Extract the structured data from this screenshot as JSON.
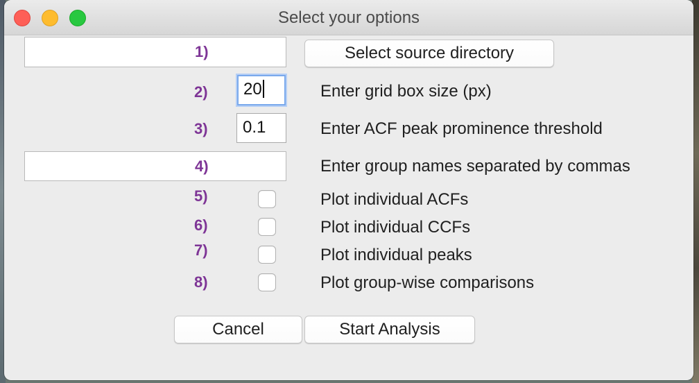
{
  "window": {
    "title": "Select your options"
  },
  "rows": [
    {
      "number": "1)",
      "button_label": "Select source directory",
      "input_value": ""
    },
    {
      "number": "2)",
      "input_value": "20",
      "label": "Enter grid box size (px)"
    },
    {
      "number": "3)",
      "input_value": "0.1",
      "label": "Enter ACF peak prominence threshold"
    },
    {
      "number": "4)",
      "input_value": "",
      "label": "Enter group names separated by commas"
    },
    {
      "number": "5)",
      "label": "Plot individual ACFs",
      "checked": false
    },
    {
      "number": "6)",
      "label": "Plot individual CCFs",
      "checked": false
    },
    {
      "number": "7)",
      "label": "Plot individual peaks",
      "checked": false
    },
    {
      "number": "8)",
      "label": "Plot group-wise comparisons",
      "checked": false
    }
  ],
  "buttons": {
    "cancel": "Cancel",
    "start": "Start Analysis"
  },
  "colors": {
    "number_color": "#7e3596",
    "focus_ring": "#7aa9ec",
    "close": "#fe5f57",
    "minimize": "#febc2e",
    "maximize": "#28c840"
  }
}
